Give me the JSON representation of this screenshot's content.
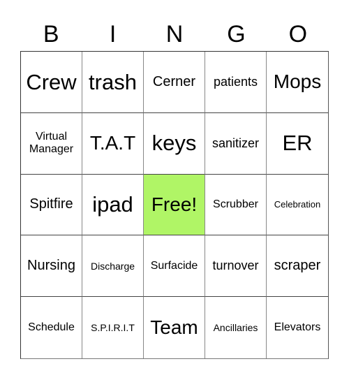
{
  "header": {
    "letters": [
      "B",
      "I",
      "N",
      "G",
      "O"
    ]
  },
  "card": {
    "free_color": "#b0f566",
    "rows": [
      [
        "Crew",
        "trash",
        "Cerner",
        "patients",
        "Mops"
      ],
      [
        "Virtual Manager",
        "T.A.T",
        "keys",
        "sanitizer",
        "ER"
      ],
      [
        "Spitfire",
        "ipad",
        "Free!",
        "Scrubber",
        "Celebration"
      ],
      [
        "Nursing",
        "Discharge",
        "Surfacide",
        "turnover",
        "scraper"
      ],
      [
        "Schedule",
        "S.P.I.R.I.T",
        "Team",
        "Ancillaries",
        "Elevators"
      ]
    ]
  }
}
